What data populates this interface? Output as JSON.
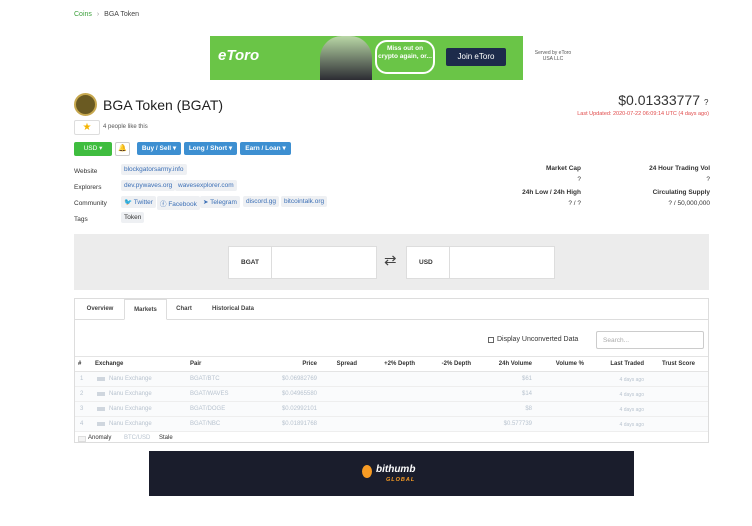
{
  "breadcrumb": {
    "parent": "Coins",
    "separator": "›",
    "current": "BGA Token"
  },
  "top_ad": {
    "brand": "eToro",
    "speech": "Miss out on crypto again, or...",
    "cta": "Join eToro",
    "sponsor": "Served by eToro USA LLC"
  },
  "coin": {
    "name": "BGA Token (BGAT)",
    "likes": "4 people like this",
    "price": "$0.01333777",
    "price_help": "?",
    "last_updated": "Last Updated: 2020-07-22 06:09:14 UTC (4 days ago)"
  },
  "actions": {
    "currency": "USD",
    "buy_sell": "Buy / Sell",
    "long_short": "Long / Short",
    "earn_loan": "Earn / Loan"
  },
  "info": {
    "website_label": "Website",
    "website": "blockgatorsarmy.info",
    "explorers_label": "Explorers",
    "explorers": [
      "dev.pywaves.org",
      "wavesexplorer.com"
    ],
    "community_label": "Community",
    "community": [
      "Twitter",
      "Facebook",
      "Telegram",
      "discord.gg",
      "bitcointalk.org"
    ],
    "tags_label": "Tags",
    "tag": "Token"
  },
  "stats": {
    "market_cap_label": "Market Cap",
    "market_cap": "?",
    "volume_label": "24 Hour Trading Vol",
    "volume": "?",
    "range_label": "24h Low / 24h High",
    "range": "? / ?",
    "supply_label": "Circulating Supply",
    "supply": "? / 50,000,000"
  },
  "converter": {
    "from": "BGAT",
    "swap": "⇄",
    "to": "USD"
  },
  "tabs": [
    "Overview",
    "Markets",
    "Chart",
    "Historical Data"
  ],
  "markets": {
    "display_unconverted": "Display Unconverted Data",
    "search_placeholder": "Search...",
    "headers": [
      "#",
      "Exchange",
      "Pair",
      "Price",
      "Spread",
      "+2% Depth",
      "-2% Depth",
      "24h Volume",
      "Volume %",
      "Last Traded",
      "Trust Score"
    ],
    "rows": [
      {
        "rank": "1",
        "exchange": "Nanu Exchange",
        "pair": "BGAT/BTC",
        "price": "$0.06982769",
        "volume": "$61",
        "last_traded": "4 days ago"
      },
      {
        "rank": "2",
        "exchange": "Nanu Exchange",
        "pair": "BGAT/WAVES",
        "price": "$0.04965580",
        "volume": "$14",
        "last_traded": "4 days ago"
      },
      {
        "rank": "3",
        "exchange": "Nanu Exchange",
        "pair": "BGAT/DOGE",
        "price": "$0.02992101",
        "volume": "$8",
        "last_traded": "4 days ago"
      },
      {
        "rank": "4",
        "exchange": "Nanu Exchange",
        "pair": "BGAT/NBC",
        "price": "$0.01891768",
        "volume": "$0.577739",
        "last_traded": "4 days ago"
      }
    ],
    "legend": [
      "Anomaly",
      "BTC/USD",
      "Stale"
    ]
  },
  "bottom_ad": {
    "brand": "bithumb",
    "sub": "GLOBAL"
  },
  "colors": {
    "green": "#3fbd3f",
    "blue": "#3d8fd1",
    "red": "#d9534f",
    "etoro": "#6ac547",
    "bithumb_bg": "#1a1d2c",
    "bithumb_accent": "#f79b24"
  }
}
